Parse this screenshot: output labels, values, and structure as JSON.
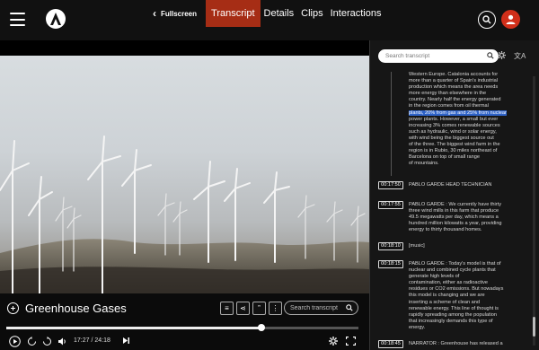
{
  "header": {
    "back_label": "Fullscreen",
    "tabs": [
      {
        "label": "Transcript",
        "active": true
      },
      {
        "label": "Details",
        "active": false
      },
      {
        "label": "Clips",
        "active": false
      },
      {
        "label": "Interactions",
        "active": false
      }
    ],
    "accent_color": "#a62d15"
  },
  "video": {
    "title": "Greenhouse Gases",
    "search_placeholder": "Search transcript",
    "timecode": "17:27 / 24:18",
    "progress_fraction": 0.725,
    "icons": [
      "playlist-icon",
      "share-icon",
      "quote-icon",
      "more-icon",
      "search-icon",
      "play-icon",
      "rewind-icon",
      "forward-icon",
      "volume-icon",
      "next-icon",
      "settings-icon",
      "fullscreen-icon"
    ]
  },
  "transcript": {
    "search_placeholder": "Search transcript",
    "blocks": [
      {
        "time": "",
        "lines": [
          "Western Europe. Catalonia accounts for",
          "more than a quarter of Spain's industrial",
          "production which means the area needs",
          "more energy than elsewhere in the",
          "country. Nearly half the energy generated",
          "in the region comes from oil thermal",
          "plants, 20% from gas and 25% from nuclear",
          "power plants. However, a small but ever",
          "increasing 3% comes renewable sources",
          "such as hydraulic, wind or solar energy,",
          "with wind being the biggest source out",
          "of the three. The biggest wind farm in the",
          "region is in Rubio, 30 miles northeast of",
          "Barcelona on top of small range",
          "of mountains."
        ]
      },
      {
        "time": "00:17:50",
        "lines": [
          "PABLO GARDE HEAD TECHNICIAN"
        ]
      },
      {
        "time": "00:17:55",
        "lines": [
          "PABLO GARDE : We currently have thirty",
          "three wind mills in this farm that produce",
          "49.5 megawatts per day, which means a",
          "hundred million kilowatts a year, providing",
          "energy to thirty thousand homes."
        ]
      },
      {
        "time": "00:18:10",
        "lines": [
          "[music]"
        ]
      },
      {
        "time": "00:18:15",
        "lines": [
          "PABLO GARDE : Today's model is that of",
          "nuclear and combined cycle plants that",
          "generate high levels of",
          "contamination, either as radioactive",
          "residues or CO2 emissions. But nowadays",
          "this model is changing and we are",
          "inserting a scheme of clean and",
          "renewable energy. This line of thought is",
          "rapidly spreading among the population",
          "that increasingly demands this type of",
          "energy."
        ]
      },
      {
        "time": "00:18:45",
        "lines": [
          "NARRATOR : Greenhouse has released a"
        ]
      }
    ]
  }
}
